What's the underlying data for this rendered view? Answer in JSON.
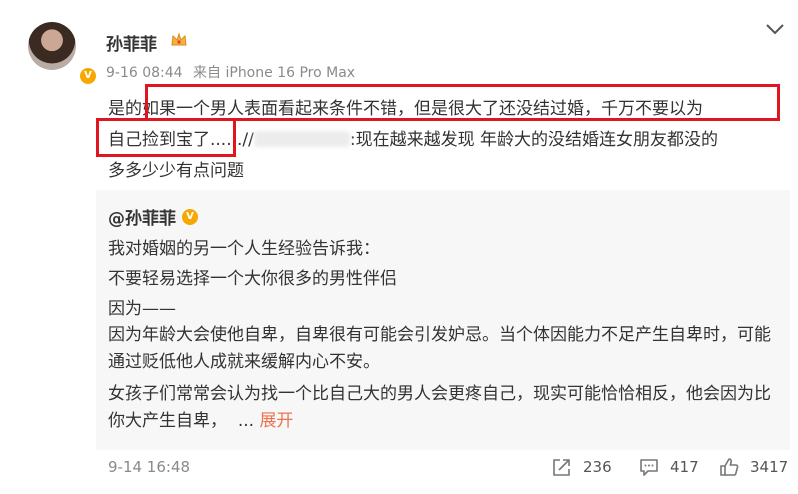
{
  "post": {
    "username": "孙菲菲",
    "meta": {
      "date": "9-16 08:44",
      "source": "来自 iPhone 16 Pro Max"
    },
    "body": {
      "prefix": "是的",
      "line1_rest": "如果一个男人表面看起来条件不错，但是很大了还没结过婚，千万不要以为",
      "line2_start": "自己捡到宝了...",
      "line2_sep": "...//",
      "line2_after_blur": ":现在越来越发现 年龄大的没结婚连女朋友都没的",
      "line3": "多多少少有点问题"
    }
  },
  "quoted": {
    "author": "@孙菲菲",
    "line1": "我对婚姻的另一个人生经验告诉我：",
    "line2": "不要轻易选择一个大你很多的男性伴侣",
    "line3": "因为——",
    "para1": "因为年龄大会使他自卑，自卑很有可能会引发妒忌。当个体因能力不足产生自卑时，可能通过贬低他人成就来缓解内心不安。",
    "para2": "女孩子们常常会认为找一个比自己大的男人会更疼自己，现实可能恰恰相反，他会因为比你大产生自卑，",
    "ellipsis": "...",
    "expand_label": "展开"
  },
  "footer": {
    "date": "9-14 16:48",
    "share_count": "236",
    "comment_count": "417",
    "like_count": "3417"
  },
  "colors": {
    "highlight": "#e1151f",
    "link": "#eb7350",
    "verified_badge": "#f7a800"
  },
  "icons": {
    "chevron": "chevron-down-icon",
    "crown": "crown-icon",
    "share": "share-icon",
    "comment": "comment-icon",
    "like": "thumbs-up-icon"
  }
}
